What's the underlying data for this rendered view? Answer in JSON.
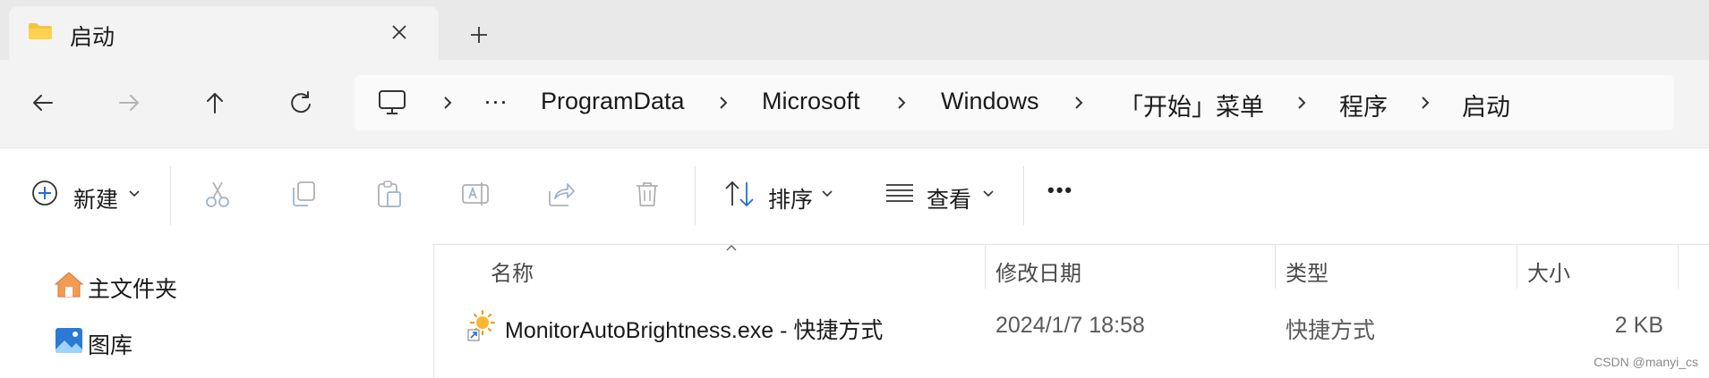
{
  "tab": {
    "title": "启动",
    "folder_icon": "folder-icon",
    "close_icon": "close-icon",
    "new_tab_icon": "plus-icon"
  },
  "nav": {
    "back_icon": "arrow-left-icon",
    "forward_icon": "arrow-right-icon",
    "up_icon": "arrow-up-icon",
    "refresh_icon": "refresh-icon"
  },
  "address": {
    "root_icon": "this-pc-icon",
    "overflow": "···",
    "crumbs": [
      "ProgramData",
      "Microsoft",
      "Windows",
      "「开始」菜单",
      "程序",
      "启动"
    ]
  },
  "commands": {
    "new_label": "新建",
    "sort_label": "排序",
    "view_label": "查看",
    "more_label": "•••",
    "icons": [
      "add-circle-icon",
      "cut-icon",
      "copy-icon",
      "paste-icon",
      "rename-icon",
      "share-icon",
      "delete-icon",
      "sort-icon",
      "view-icon",
      "more-icon"
    ]
  },
  "sidebar": {
    "items": [
      {
        "label": "主文件夹",
        "icon": "home-icon"
      },
      {
        "label": "图库",
        "icon": "gallery-icon"
      }
    ]
  },
  "filelist": {
    "columns": {
      "name": "名称",
      "modified": "修改日期",
      "type": "类型",
      "size": "大小"
    },
    "rows": [
      {
        "name": "MonitorAutoBrightness.exe - 快捷方式",
        "modified": "2024/1/7 18:58",
        "type": "快捷方式",
        "size": "2 KB",
        "icon": "shortcut-sun-icon"
      }
    ]
  },
  "watermark": "CSDN @manyi_cs"
}
